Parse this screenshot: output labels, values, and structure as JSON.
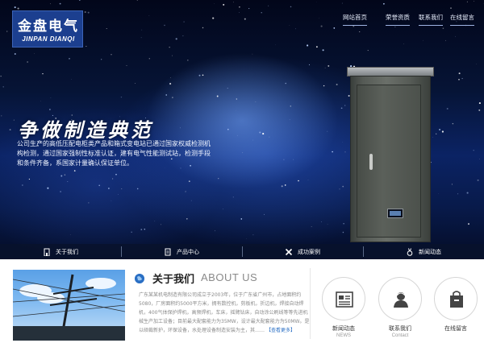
{
  "logo": {
    "cn": "金盘电气",
    "en": "JINPAN DIANQI"
  },
  "nav": [
    {
      "label": "网站首页"
    },
    {
      "label": "荣誉资质"
    },
    {
      "label": "联系我们"
    },
    {
      "label": "在线留言"
    }
  ],
  "hero": {
    "slogan": "争做制造典范",
    "description": "公司生产的高低压配电柜类产品和箱式变电站已通过国家权威检测机构检测，通过国家强制性标准认证，建有电气性能测试站，检测手段和条件齐备，系国家计量确认保证单位。"
  },
  "features": [
    {
      "label": "关于我们",
      "icon": "building-icon"
    },
    {
      "label": "产品中心",
      "icon": "document-icon"
    },
    {
      "label": "成功案例",
      "icon": "tools-icon"
    },
    {
      "label": "新闻动态",
      "icon": "medal-icon"
    }
  ],
  "about": {
    "title": "关于我们",
    "title_en": "ABOUT US",
    "text": "广东某某机电制造有限公司成立于2003年，位于广东省广州市，占地面积约5080，厂房面积约5000平方米，拥有数控机，剪板机，折边机，焊接自动焊机，400气体保护焊机，高频焊机，车床，摇臂钻床，自动涂公刷线等等先进机械生产加工设备；目前最大配套能力为35MW，设计最大配套能力为50MW。是以硕裁新护，环保设备，水处理设备制造安装为主，其……",
    "more": "【查看更多】"
  },
  "quick_links": [
    {
      "label": "新闻动态",
      "sub": "NEWS",
      "icon": "newspaper-icon"
    },
    {
      "label": "联系我们",
      "sub": "Contact",
      "icon": "person-icon"
    },
    {
      "label": "在线留言",
      "sub": "",
      "icon": "shopping-bag-icon"
    }
  ],
  "colors": {
    "accent": "#2a6fc4",
    "logo_bg": "#1c3f8f",
    "feature_bar": "#08122c"
  }
}
